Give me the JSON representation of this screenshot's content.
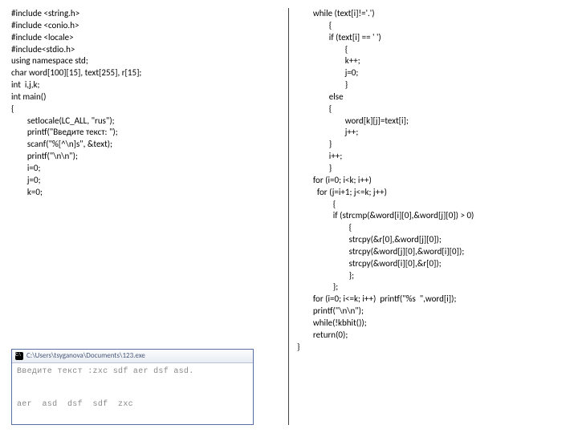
{
  "left_code": "#include <string.h>\n#include <conio.h>\n#include <locale>\n#include<stdio.h>\nusing namespace std;\nchar word[100][15], text[255], r[15];\nint  i,j,k;\nint main()\n{\n        setlocale(LC_ALL, \"rus\");\n        printf(\"Введите текст: \");\n        scanf(\"%[^\\n]s\", &text);\n        printf(\"\\n\\n\");\n        i=0;\n        j=0;\n        k=0;",
  "right_code": "        while (text[i]!='.')\n                {\n                if (text[i] == ' ')\n                        {\n                        k++;\n                        j=0;\n                        }\n                else\n                {\n                        word[k][j]=text[i];\n                        j++;\n                }\n                i++;\n                }\n        for (i=0; i<k; i++)\n          for (j=i+1; j<=k; j++)\n                  {\n                  if (strcmp(&word[i][0],&word[j][0]) > 0)\n                          {\n                          strcpy(&r[0],&word[j][0]);\n                          strcpy(&word[j][0],&word[i][0]);\n                          strcpy(&word[i][0],&r[0]);\n                          };\n                  };\n        for (i=0; i<=k; i++)  printf(\"%s  \",word[i]);\n        printf(\"\\n\\n\");\n        while(!kbhit());\n        return(0);\n}",
  "console": {
    "title": "C:\\Users\\tsyganova\\Documents\\123.exe",
    "body": "Введите текст :zxc sdf aer dsf asd.\n\n\naer  asd  dsf  sdf  zxc"
  }
}
